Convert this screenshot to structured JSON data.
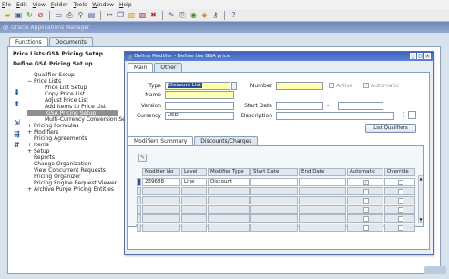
{
  "menubar": [
    "File",
    "Edit",
    "View",
    "Folder",
    "Tools",
    "Window",
    "Help"
  ],
  "back_window": {
    "title": "Oracle Applications Manager",
    "tabs": [
      "Functions",
      "Documents"
    ],
    "breadcrumb_1": "Price Lists:GSA Pricing Setup",
    "breadcrumb_2": "Define GSA Pricing Set up",
    "nav": [
      {
        "label": "Qualifier Setup",
        "level": 1,
        "prefix": ""
      },
      {
        "label": "Price Lists",
        "level": 1,
        "prefix": "−"
      },
      {
        "label": "Price List Setup",
        "level": 2,
        "prefix": ""
      },
      {
        "label": "Copy Price List",
        "level": 2,
        "prefix": ""
      },
      {
        "label": "Adjust Price List",
        "level": 2,
        "prefix": ""
      },
      {
        "label": "Add Items to Price List",
        "level": 2,
        "prefix": ""
      },
      {
        "label": "GSA Pricing Setup",
        "level": 2,
        "prefix": "",
        "selected": true
      },
      {
        "label": "Multi-Currency Conversion Setup",
        "level": 2,
        "prefix": ""
      },
      {
        "label": "Pricing Formulas",
        "level": 1,
        "prefix": "+"
      },
      {
        "label": "Modifiers",
        "level": 1,
        "prefix": "+"
      },
      {
        "label": "Pricing Agreements",
        "level": 1,
        "prefix": ""
      },
      {
        "label": "Items",
        "level": 1,
        "prefix": "+"
      },
      {
        "label": "Setup",
        "level": 1,
        "prefix": "+"
      },
      {
        "label": "Reports",
        "level": 1,
        "prefix": ""
      },
      {
        "label": "Change Organization",
        "level": 1,
        "prefix": ""
      },
      {
        "label": "View Concurrent Requests",
        "level": 1,
        "prefix": ""
      },
      {
        "label": "Pricing Organizer",
        "level": 1,
        "prefix": ""
      },
      {
        "label": "Pricing Engine Request Viewer",
        "level": 1,
        "prefix": ""
      },
      {
        "label": "Archive Purge Pricing Entities",
        "level": 1,
        "prefix": "+"
      }
    ]
  },
  "modal": {
    "title": "Define Modifier - Define the GSA price",
    "tabs": [
      "Main",
      "Other"
    ],
    "labels": {
      "type": "Type",
      "name": "Name",
      "version": "Version",
      "currency": "Currency",
      "number": "Number",
      "start_date": "Start Date",
      "description": "Description",
      "active": "Active",
      "automatic": "Automatic"
    },
    "values": {
      "type": "Discount List",
      "name": "",
      "version": "",
      "currency": "USD",
      "number": "",
      "start_date": "",
      "end_date": "",
      "description": ""
    },
    "date_sep": "-",
    "desc_bracket": "[",
    "list_qualifiers_button": "List Qualifiers",
    "lower_tabs": [
      "Modifiers Summary",
      "Discounts/Charges"
    ],
    "columns": [
      "Modifier No",
      "Level",
      "Modifier Type",
      "Start Date",
      "End Date",
      "Automatic",
      "Override"
    ],
    "rows": [
      {
        "modifier_no": "239688",
        "level": "Line",
        "modifier_type": "Discount",
        "start_date": "",
        "end_date": ""
      }
    ],
    "empty_rows": 5
  }
}
